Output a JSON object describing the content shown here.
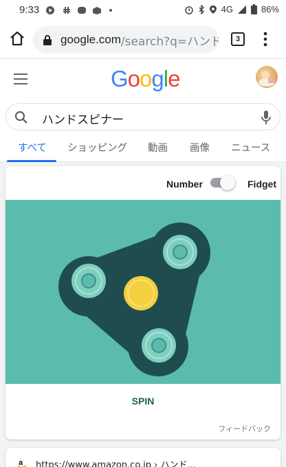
{
  "status_bar": {
    "time": "9:33",
    "network": "4G",
    "battery": "86%"
  },
  "browser": {
    "url_host": "google.com",
    "url_path": "/search?q=ハンド",
    "tab_count": "3"
  },
  "search": {
    "query": "ハンドスピナー",
    "tabs": [
      {
        "label": "すべて"
      },
      {
        "label": "ショッピング"
      },
      {
        "label": "動画"
      },
      {
        "label": "画像"
      },
      {
        "label": "ニュース"
      }
    ]
  },
  "spinner_card": {
    "number_label": "Number",
    "fidget_label": "Fidget",
    "spin_label": "SPIN",
    "feedback": "フィードバック",
    "colors": {
      "background": "#5bbcad",
      "body": "#1f4d4f",
      "center": "#f4d03f"
    }
  },
  "result": {
    "url": "https://www.amazon.co.jp › ハンド..."
  },
  "icons": [
    "home-icon",
    "lock-icon",
    "menu-icon",
    "search-icon",
    "mic-icon",
    "more-vert-icon"
  ]
}
